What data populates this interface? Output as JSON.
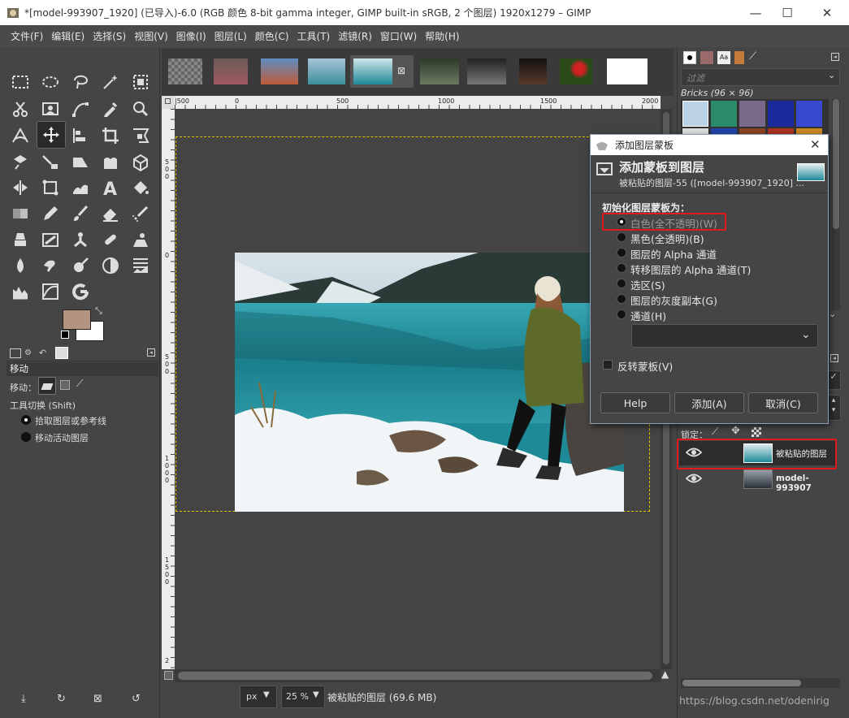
{
  "window": {
    "title": "*[model-993907_1920] (已导入)-6.0 (RGB 颜色 8-bit gamma integer, GIMP built-in sRGB, 2 个图层) 1920x1279 – GIMP",
    "minimize": "—",
    "maximize": "☐",
    "close": "✕"
  },
  "menu": [
    "文件(F)",
    "编辑(E)",
    "选择(S)",
    "视图(V)",
    "图像(I)",
    "图层(L)",
    "颜色(C)",
    "工具(T)",
    "滤镜(R)",
    "窗口(W)",
    "帮助(H)"
  ],
  "tool_options": {
    "title": "移动",
    "move_label": "移动：",
    "tool_switch": "工具切换  (Shift)",
    "options": [
      "拾取图层或参考线",
      "移动活动图层"
    ]
  },
  "rulers": {
    "h": [
      "0",
      "500",
      "1000",
      "1500",
      "2000"
    ],
    "h_negative": "|500",
    "v": [
      "5",
      "0",
      "0",
      "0",
      "5",
      "0",
      "0",
      "1",
      "0",
      "0",
      "0",
      "1",
      "5",
      "0",
      "0",
      "2"
    ]
  },
  "status": {
    "unit": "px",
    "zoom": "25 %",
    "layer_info": "被粘贴的图层 (69.6 MB)"
  },
  "dock": {
    "filter_placeholder": "过滤",
    "brush_name": "Bricks (96 × 96)",
    "lock_label": "锁定：",
    "layers": [
      {
        "name": "被粘贴的图层",
        "visible": true
      },
      {
        "name": "model-993907",
        "visible": true
      }
    ],
    "watermark": "https://blog.csdn.net/odenirig"
  },
  "dialog": {
    "window_title": "添加图层蒙板",
    "heading": "添加蒙板到图层",
    "subheading": "被粘贴的图层-55 ([model-993907_1920] ...",
    "section": "初始化图层蒙板为：",
    "options": [
      {
        "label": "白色(全不透明)(W)",
        "checked": true
      },
      {
        "label": "黑色(全透明)(B)",
        "checked": false
      },
      {
        "label": "图层的 Alpha 通道",
        "checked": false
      },
      {
        "label": "转移图层的 Alpha 通道(T)",
        "checked": false
      },
      {
        "label": "选区(S)",
        "checked": false
      },
      {
        "label": "图层的灰度副本(G)",
        "checked": false
      },
      {
        "label": "通道(H)",
        "checked": false
      }
    ],
    "invert_label": "反转蒙板(V)",
    "buttons": {
      "help": "Help",
      "add": "添加(A)",
      "cancel": "取消(C)"
    }
  },
  "colors": {
    "fg": "#b39480",
    "bg": "#ffffff",
    "highlight": "#e01a1a"
  }
}
